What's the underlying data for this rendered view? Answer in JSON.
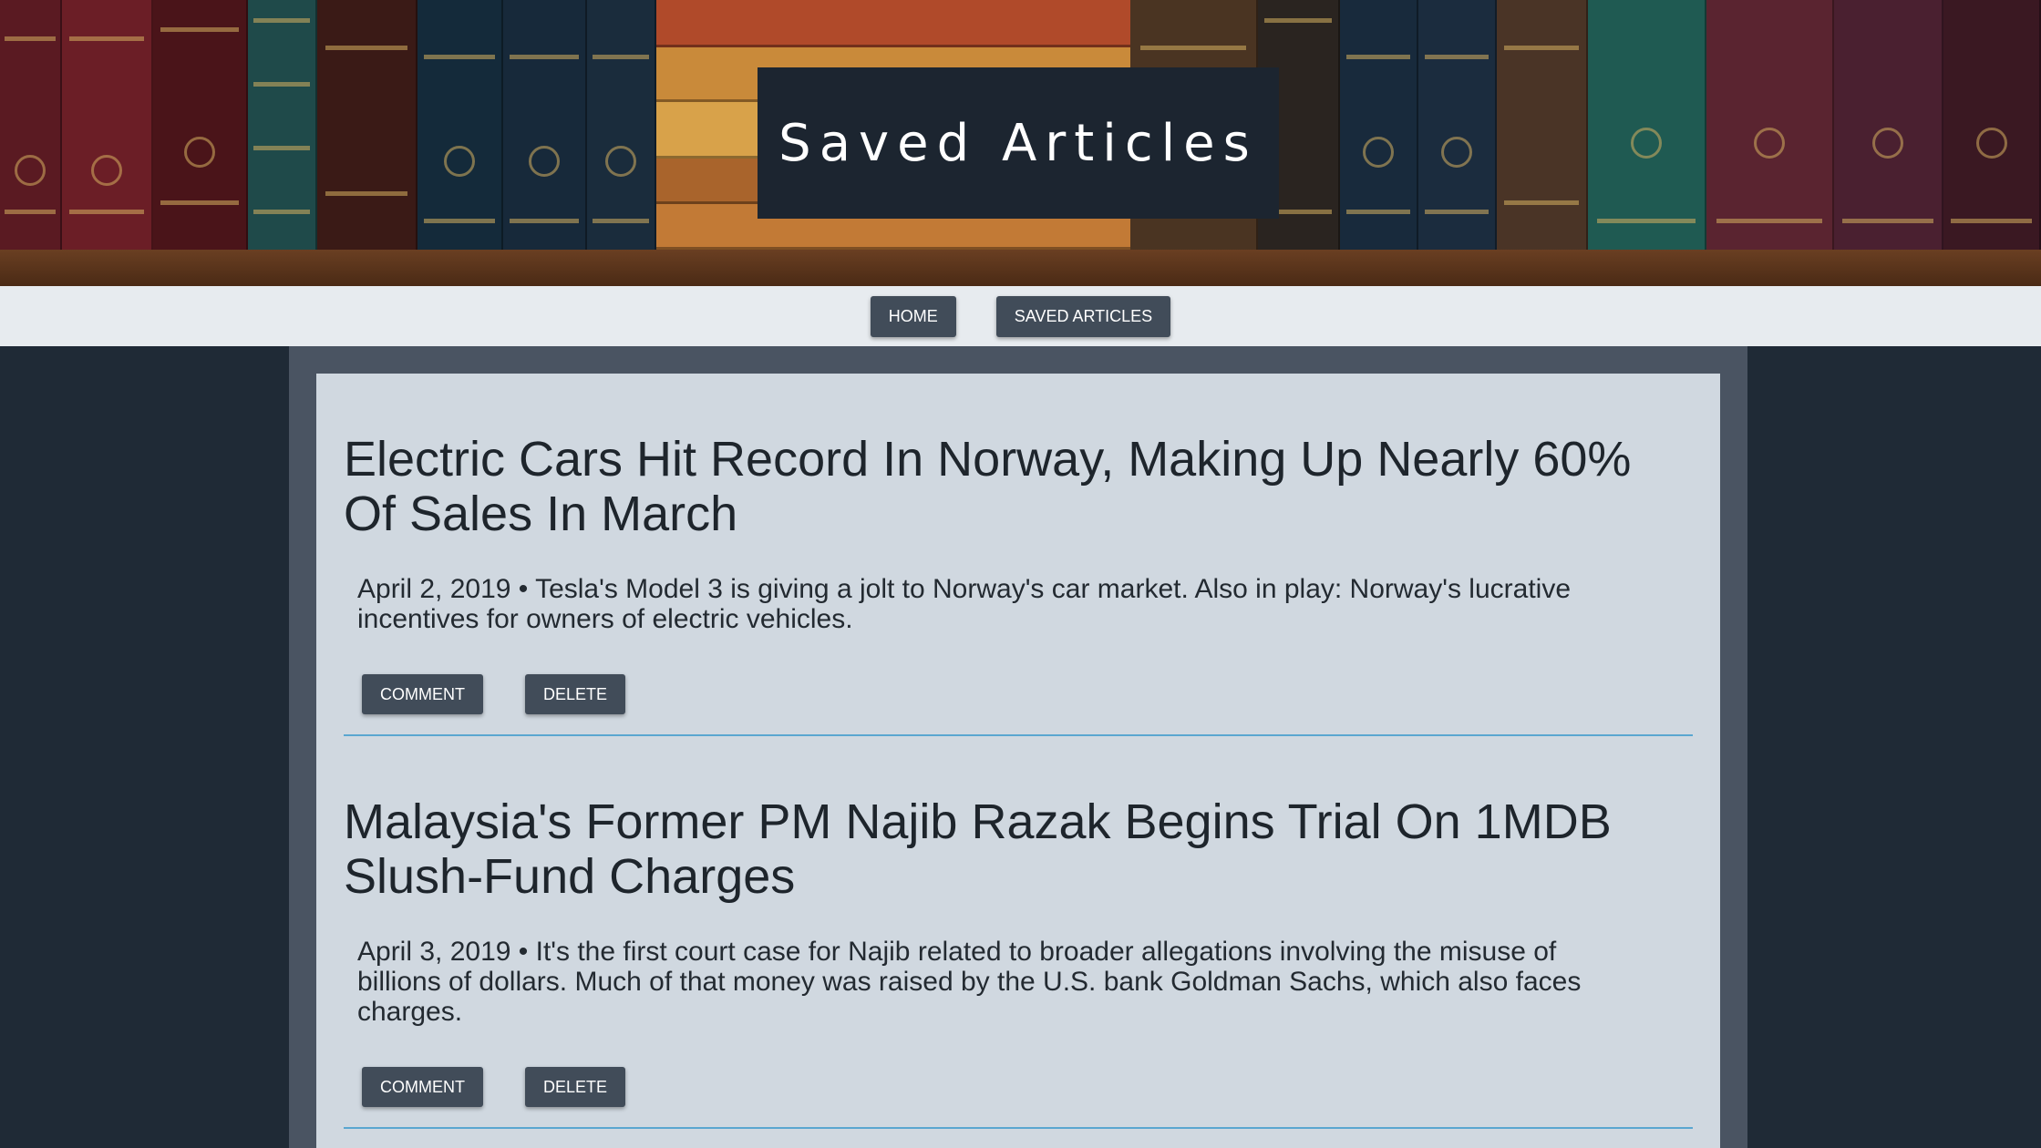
{
  "header": {
    "title": "Saved Articles"
  },
  "nav": {
    "home_label": "HOME",
    "saved_label": "SAVED ARTICLES"
  },
  "articles": [
    {
      "title": "Electric Cars Hit Record In Norway, Making Up Nearly 60% Of Sales In March",
      "summary": "April 2, 2019 • Tesla's Model 3 is giving a jolt to Norway's car market. Also in play: Norway's lucrative incentives for owners of electric vehicles.",
      "comment_label": "COMMENT",
      "delete_label": "DELETE"
    },
    {
      "title": "Malaysia's Former PM Najib Razak Begins Trial On 1MDB Slush-Fund Charges",
      "summary": "April 3, 2019 • It's the first court case for Najib related to broader allegations involving the misuse of billions of dollars. Much of that money was raised by the U.S. bank Goldman Sachs, which also faces charges.",
      "comment_label": "COMMENT",
      "delete_label": "DELETE"
    }
  ],
  "colors": {
    "page_background": "#1f2a36",
    "panel_border": "#4a5462",
    "panel_background": "#d0d8e0",
    "button_background": "#414c59",
    "divider": "#5aa6d0",
    "nav_background": "#e7ebef"
  }
}
